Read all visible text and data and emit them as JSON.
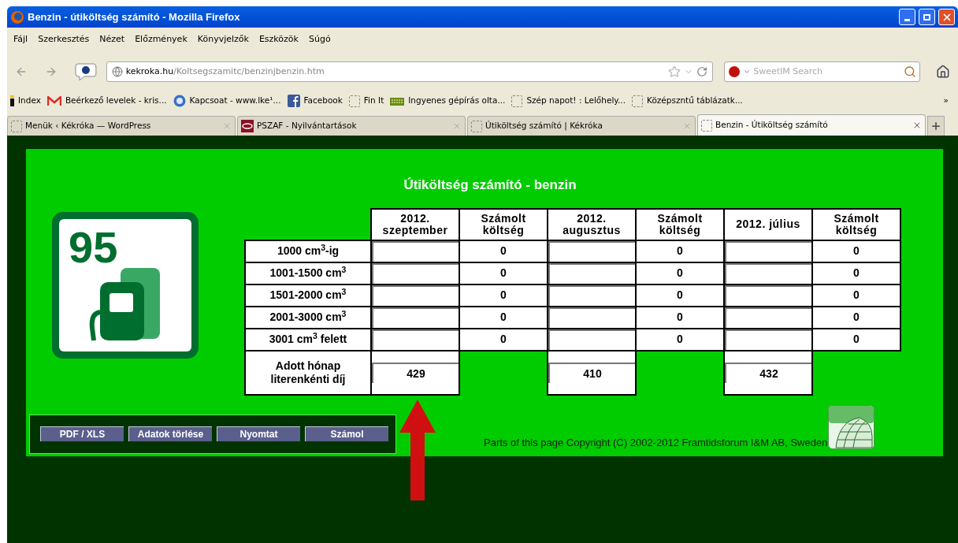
{
  "window": {
    "title": "Benzin - útiköltség számító - Mozilla Firefox"
  },
  "menu": [
    "Fájl",
    "Szerkesztés",
    "Nézet",
    "Előzmények",
    "Könyvjelzők",
    "Eszközök",
    "Súgó"
  ],
  "address": {
    "host": "kekroka.hu",
    "path": "/Koltsegszamitc/benzinjbenzin.htm"
  },
  "search": {
    "placeholder": "SweetIM Search"
  },
  "bookmarks": [
    {
      "kind": "index",
      "label": "Index"
    },
    {
      "kind": "mail",
      "label": "Beérkező levelek - kris..."
    },
    {
      "kind": "circle",
      "label": "Kapcsoat - www.lke¹..."
    },
    {
      "kind": "facebook",
      "label": "Facebook"
    },
    {
      "kind": "blank",
      "label": "Fin It"
    },
    {
      "kind": "keyboard",
      "label": "Ingyenes gépírás olta..."
    },
    {
      "kind": "blank",
      "label": "Szép napot! : Lelőhely..."
    },
    {
      "kind": "blank",
      "label": "Középszntű táblázatk..."
    }
  ],
  "bookmarks_more": "»",
  "tabs": [
    {
      "kind": "blank",
      "label": "Menük ‹ Kékróka — WordPress",
      "selected": false
    },
    {
      "kind": "pszaf",
      "label": "PSZAF - Nyilvántartások",
      "selected": false
    },
    {
      "kind": "blank",
      "label": "Útiköltség számító | Kékróka",
      "selected": false
    },
    {
      "kind": "blank",
      "label": "Benzin - Útiköltség számító",
      "selected": true
    }
  ],
  "page": {
    "title": "Útiköltség számító - benzin",
    "sign_text": "95",
    "table": {
      "columns": [
        "2012. szeptember",
        "Számolt költség",
        "2012. augusztus",
        "Számolt költség",
        "2012. július",
        "Számolt költség"
      ],
      "rows": [
        {
          "label": "1000 cm$^{3}$-ig",
          "cells": [
            {
              "kind": "input"
            },
            {
              "kind": "cost",
              "text": "0"
            },
            {
              "kind": "input"
            },
            {
              "kind": "cost",
              "text": "0"
            },
            {
              "kind": "input"
            },
            {
              "kind": "cost",
              "text": "0"
            }
          ]
        },
        {
          "label": "1001-1500 cm$^{3}$",
          "cells": [
            {
              "kind": "input"
            },
            {
              "kind": "cost",
              "text": "0"
            },
            {
              "kind": "input"
            },
            {
              "kind": "cost",
              "text": "0"
            },
            {
              "kind": "input"
            },
            {
              "kind": "cost",
              "text": "0"
            }
          ]
        },
        {
          "label": "1501-2000 cm$^{3}$",
          "cells": [
            {
              "kind": "input"
            },
            {
              "kind": "cost",
              "text": "0"
            },
            {
              "kind": "input"
            },
            {
              "kind": "cost",
              "text": "0"
            },
            {
              "kind": "input"
            },
            {
              "kind": "cost",
              "text": "0"
            }
          ]
        },
        {
          "label": "2001-3000 cm$^{3}$",
          "cells": [
            {
              "kind": "input"
            },
            {
              "kind": "cost",
              "text": "0"
            },
            {
              "kind": "input"
            },
            {
              "kind": "cost",
              "text": "0"
            },
            {
              "kind": "input"
            },
            {
              "kind": "cost",
              "text": "0"
            }
          ]
        },
        {
          "label": "3001 cm$^{3}$ felett",
          "cells": [
            {
              "kind": "input"
            },
            {
              "kind": "cost",
              "text": "0"
            },
            {
              "kind": "input"
            },
            {
              "kind": "cost",
              "text": "0"
            },
            {
              "kind": "input"
            },
            {
              "kind": "cost",
              "text": "0"
            }
          ]
        },
        {
          "label": "Adott hónap literenkénti díj",
          "cells": [
            {
              "kind": "input",
              "value": "429"
            },
            {
              "kind": "blank"
            },
            {
              "kind": "input",
              "value": "410"
            },
            {
              "kind": "blank"
            },
            {
              "kind": "input",
              "value": "432"
            },
            {
              "kind": "blank"
            }
          ]
        }
      ]
    },
    "buttons": [
      "PDF / XLS",
      "Adatok törlése",
      "Nyomtat",
      "Számol"
    ],
    "copyright": "Parts of this page Copyright (C) 2002-2012 Framtidsforum I&M AB, Sweden"
  }
}
